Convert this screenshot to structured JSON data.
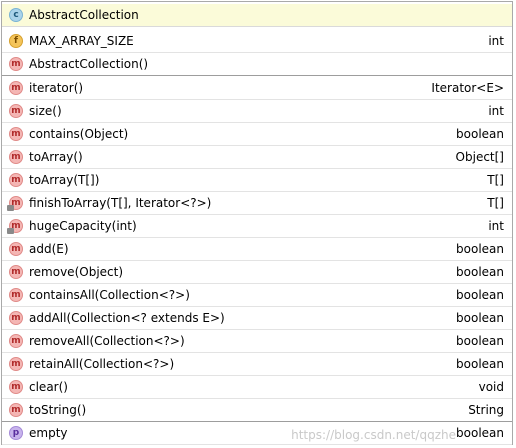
{
  "header": {
    "icon": "class-icon",
    "icon_letter": "c",
    "title": "AbstractCollection"
  },
  "members": [
    {
      "kind": "f",
      "icon": "field-icon",
      "name": "MAX_ARRAY_SIZE",
      "type": "int"
    },
    {
      "kind": "m",
      "icon": "method-icon",
      "name": "AbstractCollection()",
      "type": ""
    },
    {
      "kind": "m",
      "icon": "method-icon",
      "name": "iterator()",
      "type": "Iterator<E>"
    },
    {
      "kind": "m",
      "icon": "method-icon",
      "name": "size()",
      "type": "int"
    },
    {
      "kind": "m",
      "icon": "method-icon",
      "name": "contains(Object)",
      "type": "boolean"
    },
    {
      "kind": "m",
      "icon": "method-icon",
      "name": "toArray()",
      "type": "Object[]"
    },
    {
      "kind": "m",
      "icon": "method-icon",
      "name": "toArray(T[])",
      "type": "T[]"
    },
    {
      "kind": "m",
      "icon": "private-method-icon",
      "name": "finishToArray(T[], Iterator<?>)",
      "type": "T[]"
    },
    {
      "kind": "m",
      "icon": "private-method-icon",
      "name": "hugeCapacity(int)",
      "type": "int"
    },
    {
      "kind": "m",
      "icon": "method-icon",
      "name": "add(E)",
      "type": "boolean"
    },
    {
      "kind": "m",
      "icon": "method-icon",
      "name": "remove(Object)",
      "type": "boolean"
    },
    {
      "kind": "m",
      "icon": "method-icon",
      "name": "containsAll(Collection<?>)",
      "type": "boolean"
    },
    {
      "kind": "m",
      "icon": "method-icon",
      "name": "addAll(Collection<? extends E>)",
      "type": "boolean"
    },
    {
      "kind": "m",
      "icon": "method-icon",
      "name": "removeAll(Collection<?>)",
      "type": "boolean"
    },
    {
      "kind": "m",
      "icon": "method-icon",
      "name": "retainAll(Collection<?>)",
      "type": "boolean"
    },
    {
      "kind": "m",
      "icon": "method-icon",
      "name": "clear()",
      "type": "void"
    },
    {
      "kind": "m",
      "icon": "method-icon",
      "name": "toString()",
      "type": "String"
    },
    {
      "kind": "p",
      "icon": "property-icon",
      "name": "empty",
      "type": "boolean"
    }
  ],
  "watermark": "https://blog.csdn.net/qqzhe"
}
